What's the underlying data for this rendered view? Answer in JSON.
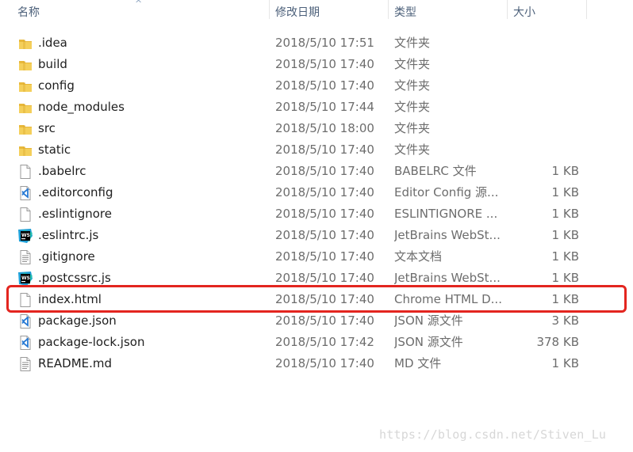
{
  "header": {
    "name": "名称",
    "date": "修改日期",
    "type": "类型",
    "size": "大小"
  },
  "rows": [
    {
      "name": ".idea",
      "date": "2018/5/10 17:51",
      "type": "文件夹",
      "size": "",
      "icon": "folder-icon"
    },
    {
      "name": "build",
      "date": "2018/5/10 17:40",
      "type": "文件夹",
      "size": "",
      "icon": "folder-icon"
    },
    {
      "name": "config",
      "date": "2018/5/10 17:40",
      "type": "文件夹",
      "size": "",
      "icon": "folder-icon"
    },
    {
      "name": "node_modules",
      "date": "2018/5/10 17:44",
      "type": "文件夹",
      "size": "",
      "icon": "folder-icon"
    },
    {
      "name": "src",
      "date": "2018/5/10 18:00",
      "type": "文件夹",
      "size": "",
      "icon": "folder-icon"
    },
    {
      "name": "static",
      "date": "2018/5/10 17:40",
      "type": "文件夹",
      "size": "",
      "icon": "folder-icon"
    },
    {
      "name": ".babelrc",
      "date": "2018/5/10 17:40",
      "type": "BABELRC 文件",
      "size": "1 KB",
      "icon": "blank-file-icon"
    },
    {
      "name": ".editorconfig",
      "date": "2018/5/10 17:40",
      "type": "Editor Config 源...",
      "size": "1 KB",
      "icon": "vscode-file-icon"
    },
    {
      "name": ".eslintignore",
      "date": "2018/5/10 17:40",
      "type": "ESLINTIGNORE ...",
      "size": "1 KB",
      "icon": "blank-file-icon"
    },
    {
      "name": ".eslintrc.js",
      "date": "2018/5/10 17:40",
      "type": "JetBrains WebSt...",
      "size": "1 KB",
      "icon": "webstorm-file-icon"
    },
    {
      "name": ".gitignore",
      "date": "2018/5/10 17:40",
      "type": "文本文档",
      "size": "1 KB",
      "icon": "text-file-icon"
    },
    {
      "name": ".postcssrc.js",
      "date": "2018/5/10 17:40",
      "type": "JetBrains WebSt...",
      "size": "1 KB",
      "icon": "webstorm-file-icon"
    },
    {
      "name": "index.html",
      "date": "2018/5/10 17:40",
      "type": "Chrome HTML D...",
      "size": "1 KB",
      "icon": "blank-file-icon",
      "highlighted": true
    },
    {
      "name": "package.json",
      "date": "2018/5/10 17:40",
      "type": "JSON 源文件",
      "size": "3 KB",
      "icon": "vscode-file-icon"
    },
    {
      "name": "package-lock.json",
      "date": "2018/5/10 17:42",
      "type": "JSON 源文件",
      "size": "378 KB",
      "icon": "vscode-file-icon"
    },
    {
      "name": "README.md",
      "date": "2018/5/10 17:40",
      "type": "MD 文件",
      "size": "1 KB",
      "icon": "text-file-icon"
    }
  ],
  "watermark": "https://blog.csdn.net/Stiven_Lu",
  "colors": {
    "highlight_border": "#e3251f",
    "folder": "#e8b83a",
    "vscode": "#2a7bd4",
    "webstorm": "#1f9fd6"
  }
}
